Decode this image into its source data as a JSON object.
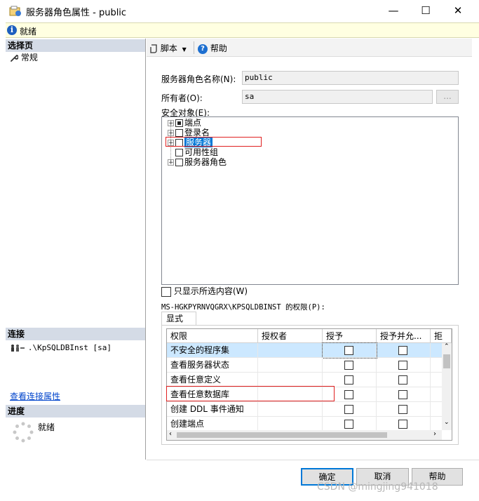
{
  "window": {
    "title": "服务器角色属性 - public",
    "minimize_glyph": "—",
    "maximize_glyph": "☐",
    "close_glyph": "✕"
  },
  "infobar": {
    "icon": "i",
    "status": "就绪"
  },
  "left": {
    "select_page_header": "选择页",
    "pages": [
      {
        "icon": "wrench-icon",
        "label": "常规"
      }
    ],
    "connection_header": "连接",
    "connection_text": ".\\KpSQLDBInst [sa]",
    "connection_link": "查看连接属性",
    "progress_header": "进度",
    "progress_status": "就绪"
  },
  "toolbar": {
    "script_label": "脚本",
    "help_label": "帮助"
  },
  "form": {
    "role_name_label": "服务器角色名称(N):",
    "role_name_value": "public",
    "owner_label": "所有者(O):",
    "owner_value": "sa",
    "browse_label": "...",
    "securables_label": "安全对象(E):",
    "tree": [
      {
        "label": "端点",
        "expandable": true,
        "state": "partial"
      },
      {
        "label": "登录名",
        "expandable": true,
        "state": "none"
      },
      {
        "label": "服务器",
        "expandable": true,
        "state": "none",
        "selected": true
      },
      {
        "label": "可用性组",
        "expandable": false,
        "state": "none"
      },
      {
        "label": "服务器角色",
        "expandable": true,
        "state": "none"
      }
    ],
    "show_selected_label": "只显示所选内容(W)",
    "permissions_label": "MS-HGKPYRNVQGRX\\KPSQLDBINST 的权限(P):",
    "tab_label": "显式"
  },
  "grid": {
    "columns": [
      "权限",
      "授权者",
      "授予",
      "授予并允...",
      "拒"
    ],
    "rows": [
      {
        "permission": "不安全的程序集",
        "grantor": "",
        "selected": true
      },
      {
        "permission": "查看服务器状态",
        "grantor": ""
      },
      {
        "permission": "查看任意定义",
        "grantor": ""
      },
      {
        "permission": "查看任意数据库",
        "grantor": ""
      },
      {
        "permission": "创建 DDL 事件通知",
        "grantor": ""
      },
      {
        "permission": "创建端点",
        "grantor": ""
      }
    ]
  },
  "buttons": {
    "ok": "确定",
    "cancel": "取消",
    "help": "帮助"
  },
  "watermark": "CSDN @mingjing941018",
  "colors": {
    "accent": "#0078d7",
    "selection": "#cce8ff",
    "highlight_red": "#e02020",
    "section_header": "#d4dbe6"
  }
}
